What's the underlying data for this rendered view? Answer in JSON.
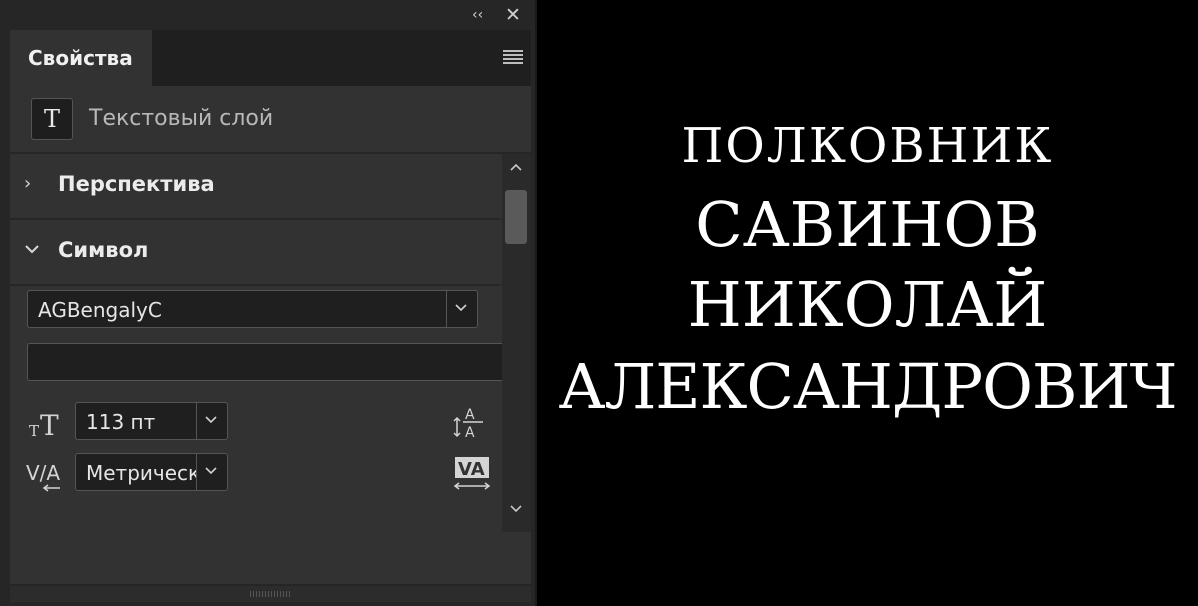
{
  "panel": {
    "tab_title": "Свойства",
    "layer_type": "Текстовый слой",
    "layer_icon_glyph": "T",
    "sections": {
      "perspective": "Перспектива",
      "symbol": "Символ"
    },
    "font_family": "AGBengalyC",
    "font_style": "",
    "font_size": "113 пт",
    "kerning": "Метрически"
  },
  "canvas": {
    "lines": [
      "ПОЛКОВНИК",
      "САВИНОВ",
      "НИКОЛАЙ",
      "АЛЕКСАНДРОВИЧ"
    ]
  },
  "icons": [
    "collapse-icon",
    "close-icon",
    "panel-menu-icon",
    "text-layer-icon",
    "chevron-right-icon",
    "chevron-down-icon",
    "font-size-icon",
    "kerning-icon",
    "leading-icon",
    "tracking-icon"
  ],
  "colors": {
    "panel_bg": "#323232",
    "tab_bar_bg": "#1f1f1f",
    "field_bg": "#1f1f1f",
    "canvas_bg": "#000000",
    "canvas_text": "#ffffff"
  }
}
